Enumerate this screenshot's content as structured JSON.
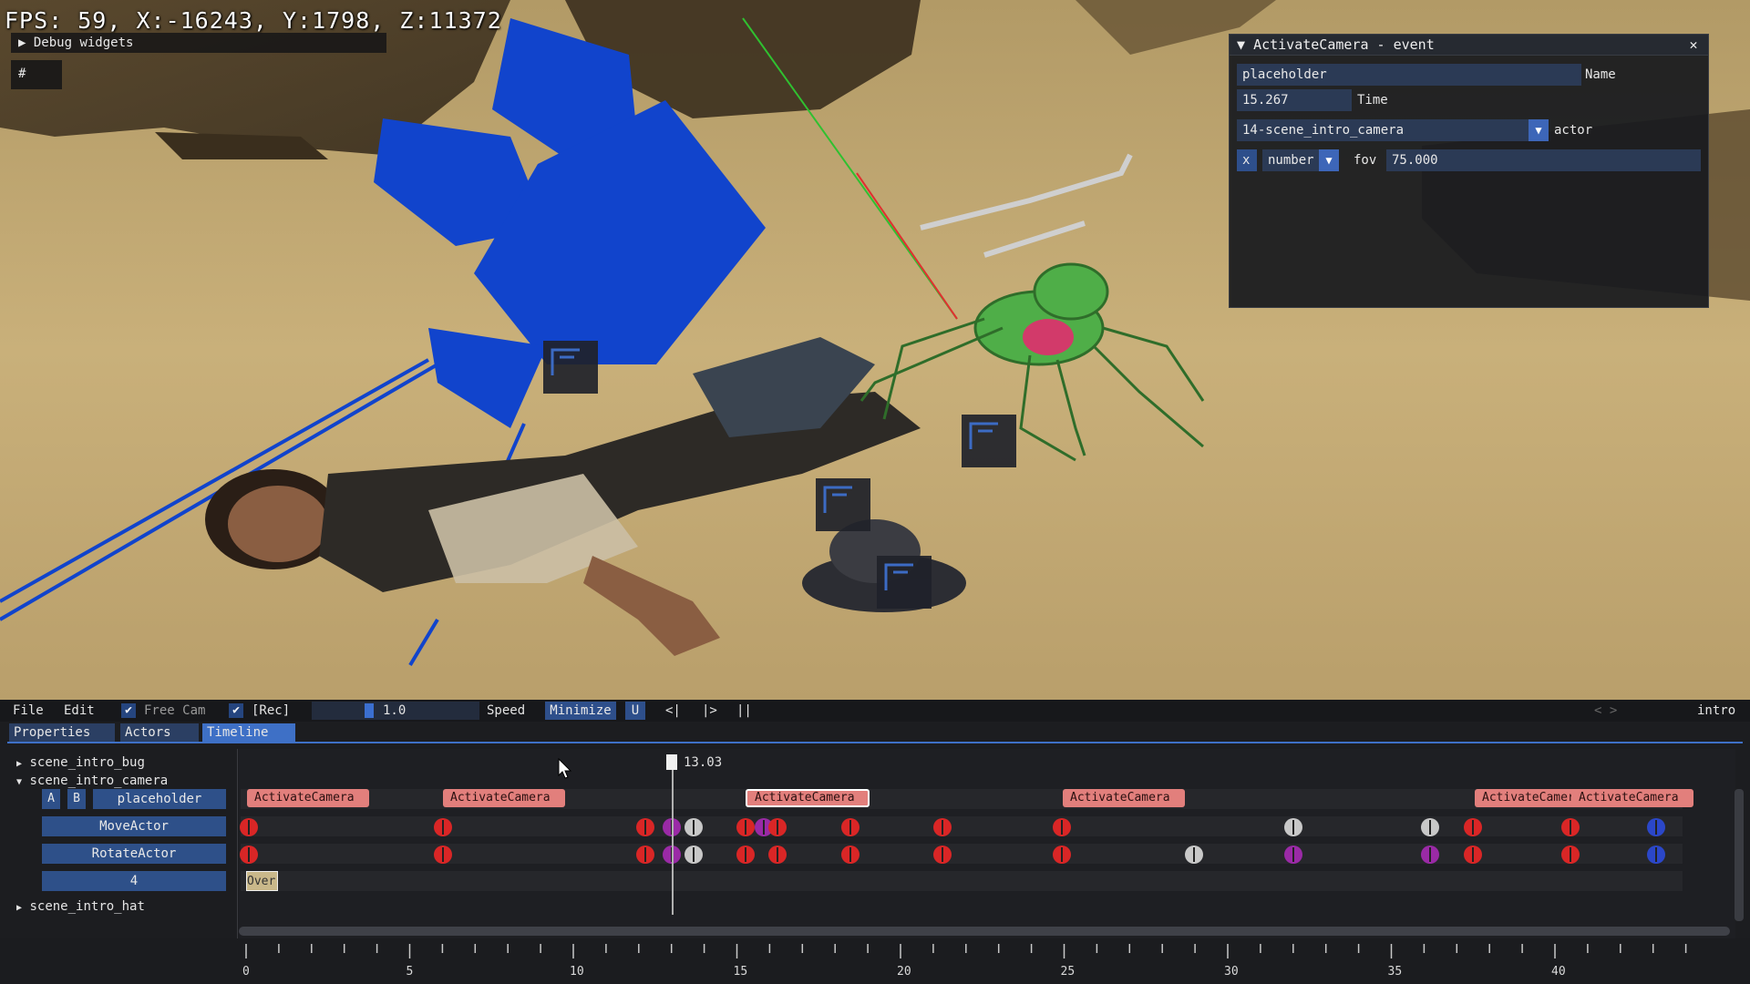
{
  "hud": {
    "fps_text": "FPS: 59, X:-16243, Y:1798, Z:11372",
    "debug_widgets_label": "Debug widgets",
    "hash_label": "#"
  },
  "event_panel": {
    "title": "ActivateCamera - event",
    "name_value": "placeholder",
    "name_label": "Name",
    "time_value": "15.267",
    "time_label": "Time",
    "actor_value": "14-scene_intro_camera",
    "actor_label": "actor",
    "remove_label": "x",
    "type_value": "number",
    "param_label": "fov",
    "param_value": "75.000"
  },
  "menubar": {
    "file": "File",
    "edit": "Edit",
    "free_cam": "Free Cam",
    "rec": "[Rec]",
    "speed_value": "1.0",
    "speed_label": "Speed",
    "minimize": "Minimize",
    "u": "U",
    "step_back": "<|",
    "step_forward": "|>",
    "pause": "||",
    "nav": "< >",
    "scene_name": "intro"
  },
  "tabs": [
    "Properties",
    "Actors",
    "Timeline"
  ],
  "tree": {
    "scene_bug": "scene_intro_bug",
    "scene_camera": "scene_intro_camera",
    "btn_a": "A",
    "btn_b": "B",
    "tracks": [
      "placeholder",
      "MoveActor",
      "RotateActor",
      "4"
    ],
    "scene_hat": "scene_intro_hat"
  },
  "timeline": {
    "playhead_time": "13.03",
    "clip_label": "ActivateCamera",
    "over_label": "Over",
    "ruler_labels": [
      "0",
      "5",
      "10",
      "15",
      "20",
      "25",
      "30",
      "35",
      "40"
    ]
  },
  "colors": {
    "accent_blue": "#3e70c6",
    "clip_red": "#e27f7c",
    "key_red": "#d92626",
    "key_purple": "#9a2aa6",
    "key_white": "#c8c8c8",
    "key_blue": "#2b47c9"
  }
}
